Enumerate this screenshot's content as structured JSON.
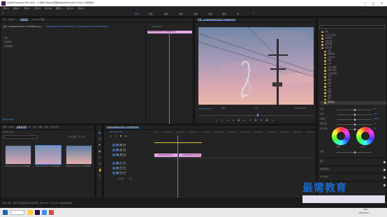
{
  "window": {
    "title": "Adobe Premiere Pro 2020 - C:\\用户\\tfstop\\文档\\Adobe\\Premiere Pro\\14.0\\未命名 *",
    "controls": [
      "—",
      "□",
      "✕"
    ]
  },
  "menu": [
    "文件(F)",
    "编辑(E)",
    "剪辑(C)",
    "序列(S)",
    "标记(M)",
    "图形(G)",
    "窗口(W)",
    "帮助(H)"
  ],
  "workspaces": [
    "学习",
    "组件",
    "编辑",
    "颜色",
    "效果",
    "音频",
    "图形",
    "库"
  ],
  "source_panel": {
    "tabs": [
      "源：（无剪辑）",
      "效果控件",
      "Lumetri 范围"
    ],
    "seq_path": "主要 * 594E0AE69A1FE03 CD4FBE1EA3.jpg",
    "seq_path2": "594E0AE69A1FE03 CD4FBE1EA3 * 594E0AE69A1FE03 CD4FBE1EA3",
    "timecode_head": "00:00:00:00",
    "clip_label": "594E0AE69A1FE03 CD4FBE1EA3.jpg",
    "fx_rows": [
      "运动",
      "不透明度",
      "时间重映射"
    ],
    "bottom_tc": "00:00:00:00"
  },
  "program_monitor": {
    "title": "节目：594E0AE69A1FE03 CD4FBE1EA3",
    "current_time": "00:00:23:05",
    "fit": "适合",
    "quality": "1/2",
    "duration": "00:00:45:20"
  },
  "project_panel": {
    "tabs": [
      "项目：未命名",
      "媒体浏览器",
      "库",
      "信息",
      "效果",
      "标记",
      "历史记录"
    ],
    "project_name": "未命名.prproj",
    "items_count": "1 项已选择，共 3 项",
    "items": [
      {
        "name": "594E0AE69A1FE03 CD4FBE1EA3",
        "dur": "5:00"
      },
      {
        "name": "594E0AE69A1FE03 CD4FBE1EA3",
        "dur": "5:00"
      },
      {
        "name": "594E0AE69A1FE03 CD4FBE1EA3",
        "dur": "5:00"
      }
    ]
  },
  "timeline": {
    "tab": "594E0AE69A1FE03 CD4FBE1EA3",
    "timecode": "00:00:23:05",
    "ruler": [
      "00:00",
      "00:00:05:00",
      "00:00:10:00",
      "00:00:15:00",
      "00:00:20:00",
      "00:00:25:00",
      "00:00:30:00",
      "00:00:35:00",
      "00:00:40:00",
      "00:00:45:00",
      "00:00:50:00",
      "00:00:55:00",
      "00:01:00:00"
    ],
    "video_tracks": [
      "V3",
      "V2",
      "V1"
    ],
    "audio_tracks": [
      "A1",
      "A2",
      "A3"
    ],
    "master": "主声道",
    "master_val": "0.0",
    "clips": [
      "594E0AE69A1FE03",
      "594E0AE69A1FE03 CD"
    ]
  },
  "effects_panel": {
    "items": [
      "预设",
      "Lumetri 预设",
      "音频效果",
      "音频过渡",
      "视频效果",
      "视频过渡",
      "变换",
      "图像控制",
      "实用程序",
      "扭曲",
      "时间",
      "杂色与颗粒",
      "模糊与锐化",
      "沉浸式视频",
      "生成",
      "视频",
      "调整",
      "过时",
      "过渡",
      "透视",
      "通道",
      "键控",
      "颜色校正"
    ],
    "selected": "颜色校正"
  },
  "lumetri": {
    "sliders": [
      "色温",
      "色调",
      "饱和度",
      "阴影色彩",
      "高光色彩"
    ],
    "wheel_labels": [
      "阴影",
      "高光"
    ],
    "balance": "平衡",
    "toggles": [
      "面具",
      "色相饱和度",
      "HSL 辅助",
      "晕影"
    ],
    "values": [
      "0.0",
      "0.0",
      "100.0",
      "0.0",
      "0.0"
    ]
  },
  "statusbar": {
    "text": "单击以选择，或单击空白处并拖动以进行框选。使用 Shift、Alt 和 Ctrl 可获得其他选项。"
  },
  "taskbar": {
    "time": "9:46",
    "date": "2021/10/13"
  },
  "watermark": {
    "text": "最需教育"
  },
  "colors": {
    "accent": "#4a8df8",
    "clip": "#e4a8e6",
    "panel": "#232323",
    "workspace_active": "#4a8df8"
  }
}
